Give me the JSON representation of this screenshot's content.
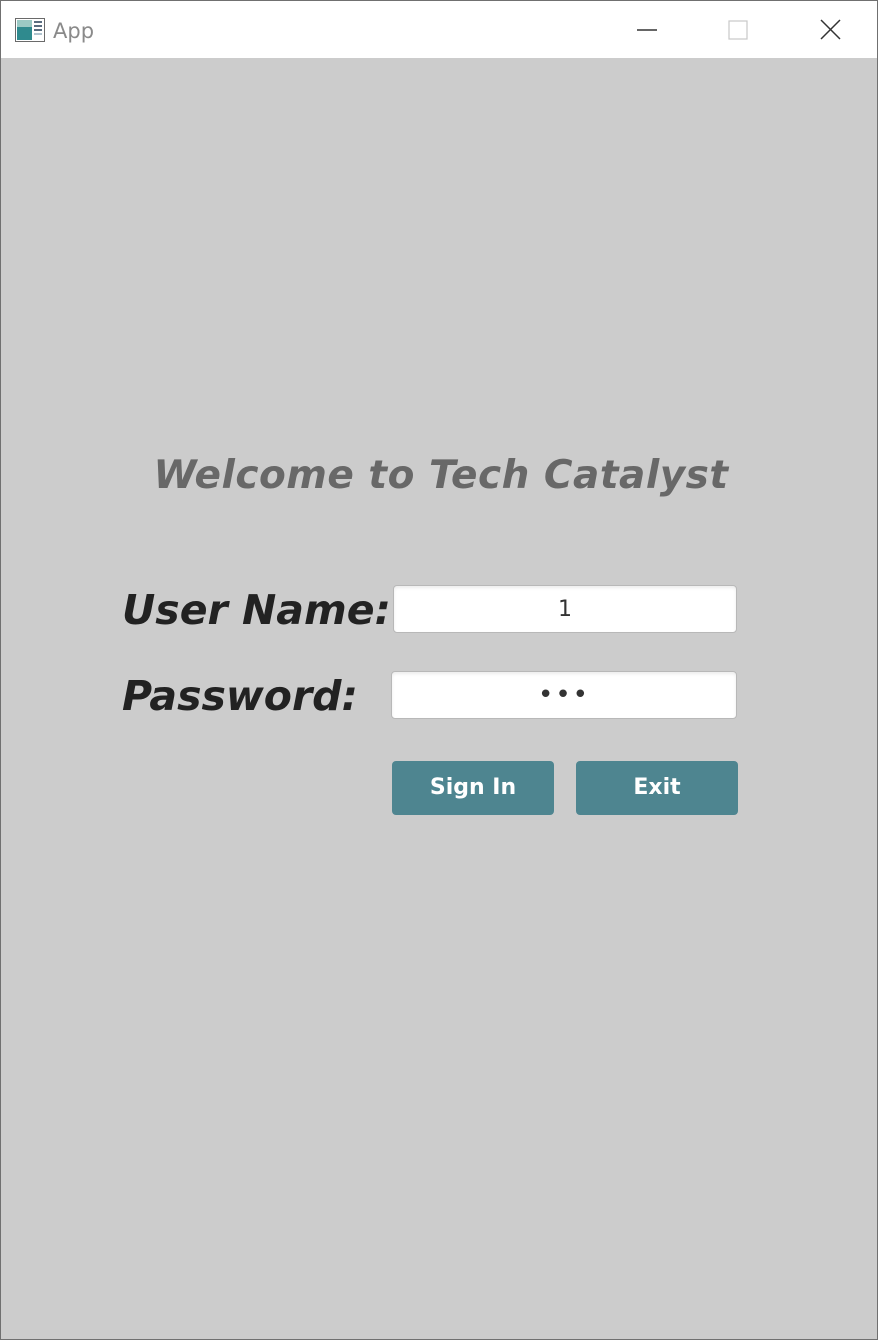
{
  "window": {
    "title": "App",
    "app_icon": "app-window-icon",
    "controls": {
      "minimize_icon": "minimize-icon",
      "maximize_icon": "maximize-icon",
      "close_icon": "close-icon"
    }
  },
  "login": {
    "heading": "Welcome to Tech Catalyst",
    "username_label": "User Name:",
    "username_value": "1",
    "password_label": "Password:",
    "password_value": "•••",
    "sign_in_label": "Sign In",
    "exit_label": "Exit"
  },
  "colors": {
    "background": "#cccccc",
    "button": "#4e8590",
    "button_text": "#ffffff",
    "heading": "#686868",
    "label": "#222222"
  }
}
